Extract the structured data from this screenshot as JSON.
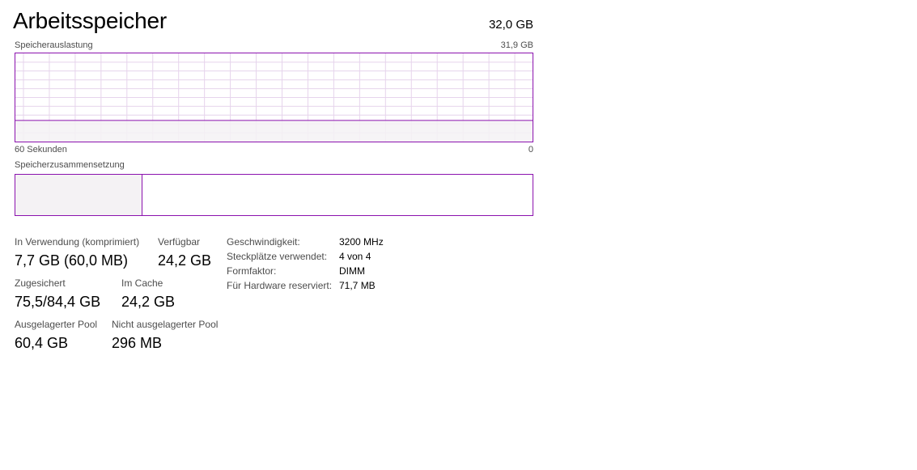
{
  "header": {
    "title": "Arbeitsspeicher",
    "total": "32,0 GB"
  },
  "usage_graph": {
    "label": "Speicherauslastung",
    "max_label": "31,9 GB",
    "time_label": "60 Sekunden",
    "end_label": "0",
    "used_fraction": 0.24
  },
  "composition": {
    "label": "Speicherzusammensetzung",
    "in_use_fraction": 0.245
  },
  "stats": {
    "in_use": {
      "label": "In Verwendung (komprimiert)",
      "value": "7,7 GB (60,0 MB)"
    },
    "available": {
      "label": "Verfügbar",
      "value": "24,2 GB"
    },
    "committed": {
      "label": "Zugesichert",
      "value": "75,5/84,4 GB"
    },
    "cached": {
      "label": "Im Cache",
      "value": "24,2 GB"
    },
    "paged_pool": {
      "label": "Ausgelagerter Pool",
      "value": "60,4 GB"
    },
    "nonpaged_pool": {
      "label": "Nicht ausgelagerter Pool",
      "value": "296 MB"
    }
  },
  "info": {
    "speed": {
      "label": "Geschwindigkeit:",
      "value": "3200 MHz"
    },
    "slots": {
      "label": "Steckplätze verwendet:",
      "value": "4 von 4"
    },
    "form_factor": {
      "label": "Formfaktor:",
      "value": "DIMM"
    },
    "reserved": {
      "label": "Für Hardware reserviert:",
      "value": "71,7 MB"
    }
  },
  "colors": {
    "accent": "#8b12ae",
    "grid": "#e6d4ec",
    "fill": "#f4f2f4"
  }
}
